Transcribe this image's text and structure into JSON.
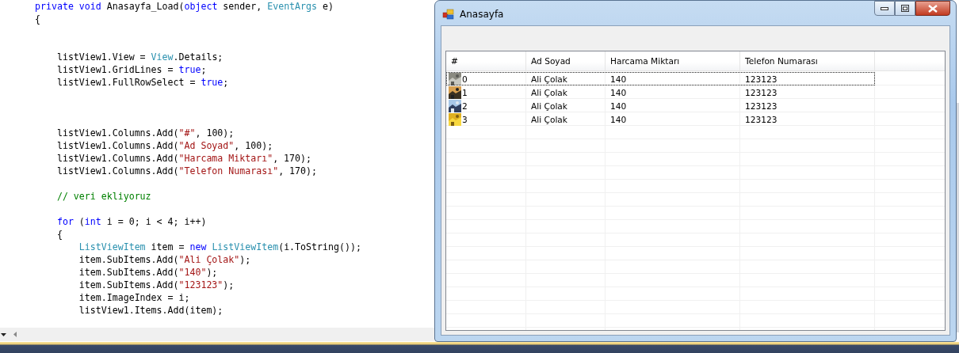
{
  "editor": {
    "lines": [
      {
        "kind": "code",
        "tokens": [
          {
            "text": "private",
            "kind": "keyword"
          },
          {
            "text": " void",
            "kind": "keyword"
          },
          {
            "text": " Anasayfa_Load(",
            "kind": "plain"
          },
          {
            "text": "object",
            "kind": "keyword"
          },
          {
            "text": " sender, ",
            "kind": "plain"
          },
          {
            "text": "EventArgs",
            "kind": "type"
          },
          {
            "text": " e)",
            "kind": "plain"
          }
        ]
      },
      {
        "kind": "code",
        "tokens": [
          {
            "text": "{",
            "kind": "plain"
          }
        ]
      },
      {
        "kind": "blank"
      },
      {
        "kind": "blank"
      },
      {
        "kind": "code",
        "tokens": [
          {
            "text": "    listView1.View = ",
            "kind": "plain"
          },
          {
            "text": "View",
            "kind": "type"
          },
          {
            "text": ".Details;",
            "kind": "plain"
          }
        ]
      },
      {
        "kind": "code",
        "tokens": [
          {
            "text": "    listView1.GridLines = ",
            "kind": "plain"
          },
          {
            "text": "true",
            "kind": "keyword"
          },
          {
            "text": ";",
            "kind": "plain"
          }
        ]
      },
      {
        "kind": "code",
        "tokens": [
          {
            "text": "    listView1.FullRowSelect = ",
            "kind": "plain"
          },
          {
            "text": "true",
            "kind": "keyword"
          },
          {
            "text": ";",
            "kind": "plain"
          }
        ]
      },
      {
        "kind": "blank"
      },
      {
        "kind": "blank"
      },
      {
        "kind": "blank"
      },
      {
        "kind": "code",
        "tokens": [
          {
            "text": "    listView1.Columns.Add(",
            "kind": "plain"
          },
          {
            "text": "\"#\"",
            "kind": "string"
          },
          {
            "text": ", 100);",
            "kind": "plain"
          }
        ]
      },
      {
        "kind": "code",
        "tokens": [
          {
            "text": "    listView1.Columns.Add(",
            "kind": "plain"
          },
          {
            "text": "\"Ad Soyad\"",
            "kind": "string"
          },
          {
            "text": ", 100);",
            "kind": "plain"
          }
        ]
      },
      {
        "kind": "code",
        "tokens": [
          {
            "text": "    listView1.Columns.Add(",
            "kind": "plain"
          },
          {
            "text": "\"Harcama Miktarı\"",
            "kind": "string"
          },
          {
            "text": ", 170);",
            "kind": "plain"
          }
        ]
      },
      {
        "kind": "code",
        "tokens": [
          {
            "text": "    listView1.Columns.Add(",
            "kind": "plain"
          },
          {
            "text": "\"Telefon Numarası\"",
            "kind": "string"
          },
          {
            "text": ", 170);",
            "kind": "plain"
          }
        ]
      },
      {
        "kind": "blank"
      },
      {
        "kind": "code",
        "tokens": [
          {
            "text": "    // veri ekliyoruz",
            "kind": "comment"
          }
        ]
      },
      {
        "kind": "blank"
      },
      {
        "kind": "code",
        "tokens": [
          {
            "text": "    for",
            "kind": "keyword"
          },
          {
            "text": " (",
            "kind": "plain"
          },
          {
            "text": "int",
            "kind": "keyword"
          },
          {
            "text": " i = 0; i < 4; i++)",
            "kind": "plain"
          }
        ]
      },
      {
        "kind": "code",
        "tokens": [
          {
            "text": "    {",
            "kind": "plain"
          }
        ]
      },
      {
        "kind": "code",
        "tokens": [
          {
            "text": "        ListViewItem",
            "kind": "type"
          },
          {
            "text": " item = ",
            "kind": "plain"
          },
          {
            "text": "new",
            "kind": "keyword"
          },
          {
            "text": " ListViewItem",
            "kind": "type"
          },
          {
            "text": "(i.ToString());",
            "kind": "plain"
          }
        ]
      },
      {
        "kind": "code",
        "tokens": [
          {
            "text": "        item.SubItems.Add(",
            "kind": "plain"
          },
          {
            "text": "\"Ali Çolak\"",
            "kind": "string"
          },
          {
            "text": ");",
            "kind": "plain"
          }
        ]
      },
      {
        "kind": "code",
        "tokens": [
          {
            "text": "        item.SubItems.Add(",
            "kind": "plain"
          },
          {
            "text": "\"140\"",
            "kind": "string"
          },
          {
            "text": ");",
            "kind": "plain"
          }
        ]
      },
      {
        "kind": "code",
        "tokens": [
          {
            "text": "        item.SubItems.Add(",
            "kind": "plain"
          },
          {
            "text": "\"123123\"",
            "kind": "string"
          },
          {
            "text": ");",
            "kind": "plain"
          }
        ]
      },
      {
        "kind": "code",
        "tokens": [
          {
            "text": "        item.ImageIndex = i;",
            "kind": "plain"
          }
        ]
      },
      {
        "kind": "code",
        "tokens": [
          {
            "text": "        listView1.Items.Add(item);",
            "kind": "plain"
          }
        ]
      }
    ]
  },
  "window": {
    "title": "Anasayfa"
  },
  "list_view": {
    "columns": [
      "#",
      "Ad Soyad",
      "Harcama Miktarı",
      "Telefon Numarası"
    ],
    "rows": [
      {
        "cells": [
          "0",
          "Ali Çolak",
          "140",
          "123123"
        ],
        "focused": true,
        "picture": {
          "kind": "picture"
        }
      },
      {
        "cells": [
          "1",
          "Ali Çolak",
          "140",
          "123123"
        ],
        "focused": false,
        "picture": {
          "kind": "picture"
        }
      },
      {
        "cells": [
          "2",
          "Ali Çolak",
          "140",
          "123123"
        ],
        "focused": false,
        "picture": {
          "kind": "picture"
        }
      },
      {
        "cells": [
          "3",
          "Ali Çolak",
          "140",
          "123123"
        ],
        "focused": false,
        "picture": {
          "kind": "picture"
        }
      }
    ]
  }
}
